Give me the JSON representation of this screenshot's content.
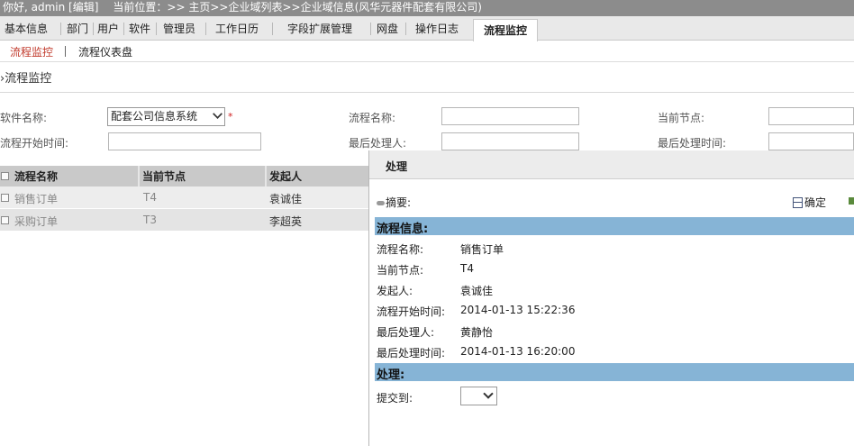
{
  "topbar": {
    "greeting": "你好, admin [编辑]",
    "location": "当前位置：>> 主页>>企业域列表>>企业域信息(风华元器件配套有限公司)"
  },
  "tabs": [
    {
      "label": "基本信息"
    },
    {
      "label": "部门"
    },
    {
      "label": "用户"
    },
    {
      "label": "软件"
    },
    {
      "label": "管理员"
    },
    {
      "label": "工作日历"
    },
    {
      "label": "字段扩展管理"
    },
    {
      "label": "网盘"
    },
    {
      "label": "操作日志"
    },
    {
      "label": "流程监控",
      "active": true
    }
  ],
  "subnav": {
    "active": "流程监控",
    "other": "流程仪表盘"
  },
  "section": {
    "title": "›流程监控"
  },
  "filters": {
    "software_label": "软件名称:",
    "software_value": "配套公司信息系统",
    "required_mark": "*",
    "flow_name_label": "流程名称:",
    "current_node_label": "当前节点:",
    "start_time_label": "流程开始时间:",
    "last_handler_label": "最后处理人:",
    "last_time_label": "最后处理时间:"
  },
  "grid": {
    "columns": [
      "流程名称",
      "当前节点",
      "发起人"
    ],
    "rows": [
      {
        "name": "销售订单",
        "node": "T4",
        "initiator": "袁诚佳"
      },
      {
        "name": "采购订单",
        "node": "T3",
        "initiator": "李超英"
      }
    ]
  },
  "dialog": {
    "title": "处理",
    "summary_label": "摘要:",
    "confirm_label": "确定",
    "info_band": "流程信息:",
    "fields": [
      {
        "label": "流程名称:",
        "value": "销售订单"
      },
      {
        "label": "当前节点:",
        "value": "T4"
      },
      {
        "label": "发起人:",
        "value": "袁诚佳"
      },
      {
        "label": "流程开始时间:",
        "value": "2014-01-13 15:22:36"
      },
      {
        "label": "最后处理人:",
        "value": "黄静怡"
      },
      {
        "label": "最后处理时间:",
        "value": "2014-01-13 16:20:00"
      }
    ],
    "process_band": "处理:",
    "submit_label": "提交到:"
  },
  "colors": {
    "accent_red": "#c0392b",
    "band_blue": "#86b4d6",
    "topbar_gray": "#8c8c8c"
  }
}
